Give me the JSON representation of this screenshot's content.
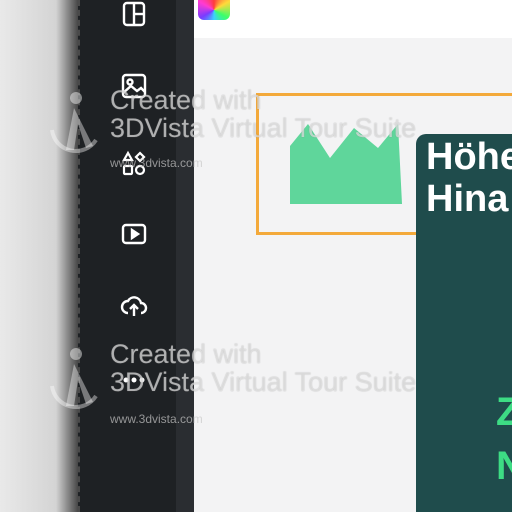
{
  "sidebar": {
    "items": [
      {
        "icon": "layout-icon"
      },
      {
        "icon": "image-icon"
      },
      {
        "icon": "elements-icon"
      },
      {
        "icon": "video-icon"
      },
      {
        "icon": "upload-cloud-icon"
      },
      {
        "icon": "more-icon"
      }
    ]
  },
  "canvas": {
    "panel": {
      "line1": "Höhe",
      "line2": "Hina",
      "accent1": "Z",
      "accent2": "N"
    }
  },
  "watermark": {
    "line1": "Created with",
    "line2": "3DVista Virtual Tour Suite",
    "url": "www.3dvista.com"
  },
  "colors": {
    "sidebar": "#1e2124",
    "panel": "#1f4c4c",
    "selection": "#f3a93a",
    "mountain": "#5fd69b",
    "accent": "#3ddc84"
  }
}
